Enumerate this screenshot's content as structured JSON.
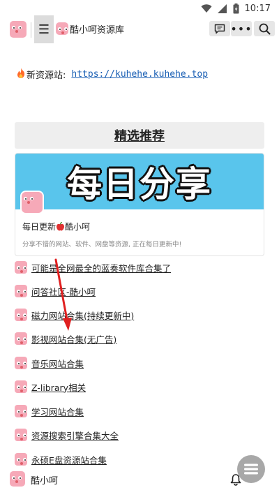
{
  "status_bar": {
    "time": "10:17"
  },
  "header": {
    "site_title": "酷小呵资源库",
    "menu_icon": "menu-icon",
    "comment_icon": "comment-icon",
    "more_label": "•••",
    "search_icon": "search-icon"
  },
  "notice": {
    "prefix": "新资源站:",
    "link": "https://kuhehe.kuhehe.top"
  },
  "section": {
    "title": "精选推荐"
  },
  "card": {
    "banner_text": "每日分享",
    "title": "每日更新",
    "title_suffix": "酷小呵",
    "description": "分享不错的网站、软件、网盘等资源, 正在每日更新中!"
  },
  "list": [
    {
      "label": "可能是全网最全的蓝奏软件库合集了"
    },
    {
      "label": "问答社区-酷小呵"
    },
    {
      "label": "磁力网站合集(持续更新中)"
    },
    {
      "label": "影视网站合集(无广告)"
    },
    {
      "label": "音乐网站合集"
    },
    {
      "label": "Z-library相关"
    },
    {
      "label": "学习网站合集"
    },
    {
      "label": "资源搜索引擎合集大全"
    },
    {
      "label": "永硕E盘资源站合集"
    }
  ],
  "bottom": {
    "user_name": "酷小呵"
  },
  "colors": {
    "banner": "#59c5ec",
    "link": "#1a5fb4",
    "arrow": "#e02020"
  }
}
